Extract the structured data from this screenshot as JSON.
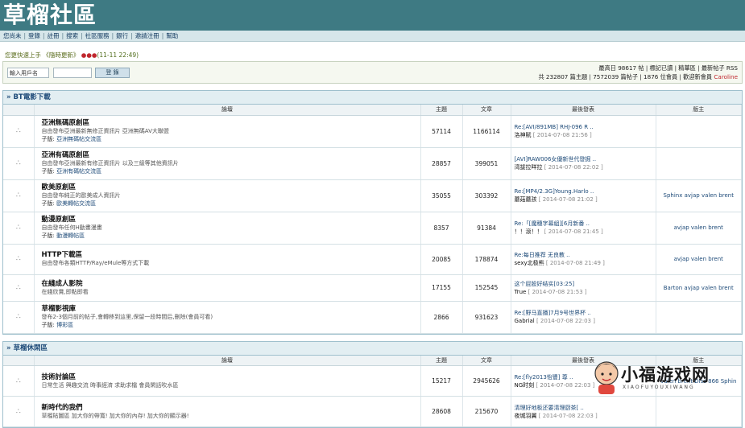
{
  "header": {
    "logo": "草榴社區"
  },
  "nav": {
    "items": [
      "您尚未",
      "登錄",
      "註冊",
      "搜索",
      "社區服務",
      "銀行",
      "邀請注冊",
      "幫助"
    ]
  },
  "notice": {
    "text": "您更快速上手 《隨時更新》 ",
    "stars": "●●●",
    "time": "(11-11 22:49)"
  },
  "login": {
    "username_value": "輸入用戶名",
    "button": "登 錄"
  },
  "stats": {
    "line1": "最高日 98617 帖 | 標記已讀 | 精華區 | 最新帖子 RSS",
    "line2_prefix": "共 232807 篇主題 | 7572039 篇帖子 | 1876 位會員 | 歡迎新會員 ",
    "new_member": "Caroline"
  },
  "columns": {
    "forum": "論壇",
    "topics": "主題",
    "posts": "文章",
    "last": "最後發表",
    "mods": "版主"
  },
  "sections": [
    {
      "title": "» BT電影下載",
      "forums": [
        {
          "icon": "∴",
          "name": "亞洲無碼原創區",
          "desc": "自由發布亞洲最新無修正資訊片  亞洲無碼AV大聯盟",
          "sub_prefix": "子版:  ",
          "sub": "亞洲無碼帖交流區",
          "topics": "57114",
          "posts": "1166114",
          "last_title": "Re:[AVI/891MB] RHJ-096 R ..",
          "last_user": "洛神賦",
          "last_time": "[ 2014-07-08 21:56 ]",
          "mods": ""
        },
        {
          "icon": "∴",
          "name": "亞洲有碼原創區",
          "desc": "自由發布亞洲最新有修正資訊片 以及三級等其他資訊片",
          "sub_prefix": "子版:  ",
          "sub": "亞洲有碼帖交流區",
          "topics": "28857",
          "posts": "399051",
          "last_title": "[AVI]RAW006女優新世代發掘 ..",
          "last_user": "湾拔拉咩拉",
          "last_time": "[ 2014-07-08 22:02 ]",
          "mods": ""
        },
        {
          "icon": "∴",
          "name": "歐美原創區",
          "desc": "自由發布純正的歐美成人資訊片",
          "sub_prefix": "子版:  ",
          "sub": "歐美轉帖交流區",
          "topics": "35055",
          "posts": "303392",
          "last_title": "Re:[MP4/2.3G]Young.Harlo ..",
          "last_user": "蘑菇蘑孩",
          "last_time": "[ 2014-07-08 21:02 ]",
          "mods": "Sphinx avjap valen brent"
        },
        {
          "icon": "∴",
          "name": "動漫原創區",
          "desc": "自由發布任何H動畫漫畫",
          "sub_prefix": "子版:  ",
          "sub": "動漫轉帖區",
          "topics": "8357",
          "posts": "91384",
          "last_title": "Re:「[魔穗字幕組][6月新番 ..",
          "last_user": "！！滾！！",
          "last_time": "[ 2014-07-08 21:45 ]",
          "mods": "avjap valen brent"
        },
        {
          "icon": "∴",
          "name": "HTTP下載區",
          "desc": "自由發布各類HTTP/Ray/eMule等方式下載",
          "sub_prefix": "",
          "sub": "",
          "topics": "20085",
          "posts": "178874",
          "last_title": "Re:每日推荐  无良教 ..",
          "last_user": "sexy北极熊",
          "last_time": "[ 2014-07-08 21:49 ]",
          "mods": "avjap valen brent"
        },
        {
          "icon": "∴",
          "name": "在綫成人影院",
          "desc": "在綫欣賞,即點即看",
          "sub_prefix": "",
          "sub": "",
          "topics": "17155",
          "posts": "152545",
          "last_title": "这个屁股好结实[03:25]",
          "last_user": "True",
          "last_time": "[ 2014-07-08 21:53 ]",
          "mods": "Barton avjap valen brent"
        },
        {
          "icon": "∴",
          "name": "草榴影視庫",
          "desc": "發布2-3個月前的帖子,會轉移到這里,保留一段時間后,刪除(會員可看)",
          "sub_prefix": "子版:  ",
          "sub": "博彩區",
          "topics": "2866",
          "posts": "931623",
          "last_title": "Re:[野马直播]7月9号世界杯 ..",
          "last_user": "Gabrial",
          "last_time": "[ 2014-07-08 22:03 ]",
          "mods": ""
        }
      ]
    },
    {
      "title": "» 草榴休閑區",
      "forums": [
        {
          "icon": "∴",
          "name": "技術討論區",
          "desc": "日常生活 興趣交流 時事經濟 求助求檔 會員閑話吹水區",
          "sub_prefix": "",
          "sub": "",
          "topics": "15217",
          "posts": "2945626",
          "last_title": "Re:[fly2013怡豐]  尊 ..",
          "last_user": "NG时刻",
          "last_time": "[ 2014-07-08 22:03 ]",
          "mods": "valen brent Diss 866 Sphin"
        },
        {
          "icon": "∴",
          "name": "新時代的我們",
          "desc": "草榴貼圖區  加大你的帶寬! 加大你的內存! 加大你的顯示器!",
          "sub_prefix": "",
          "sub": "",
          "topics": "28608",
          "posts": "215670",
          "last_title": "清理好地板还要清理厨茶[ ..",
          "last_user": "夜城羽翼",
          "last_time": "[ 2014-07-08 22:03 ]",
          "mods": ""
        }
      ]
    }
  ],
  "watermark": {
    "text": "小福游戏网",
    "sub": "XIAOFUYOUXIWANG"
  }
}
